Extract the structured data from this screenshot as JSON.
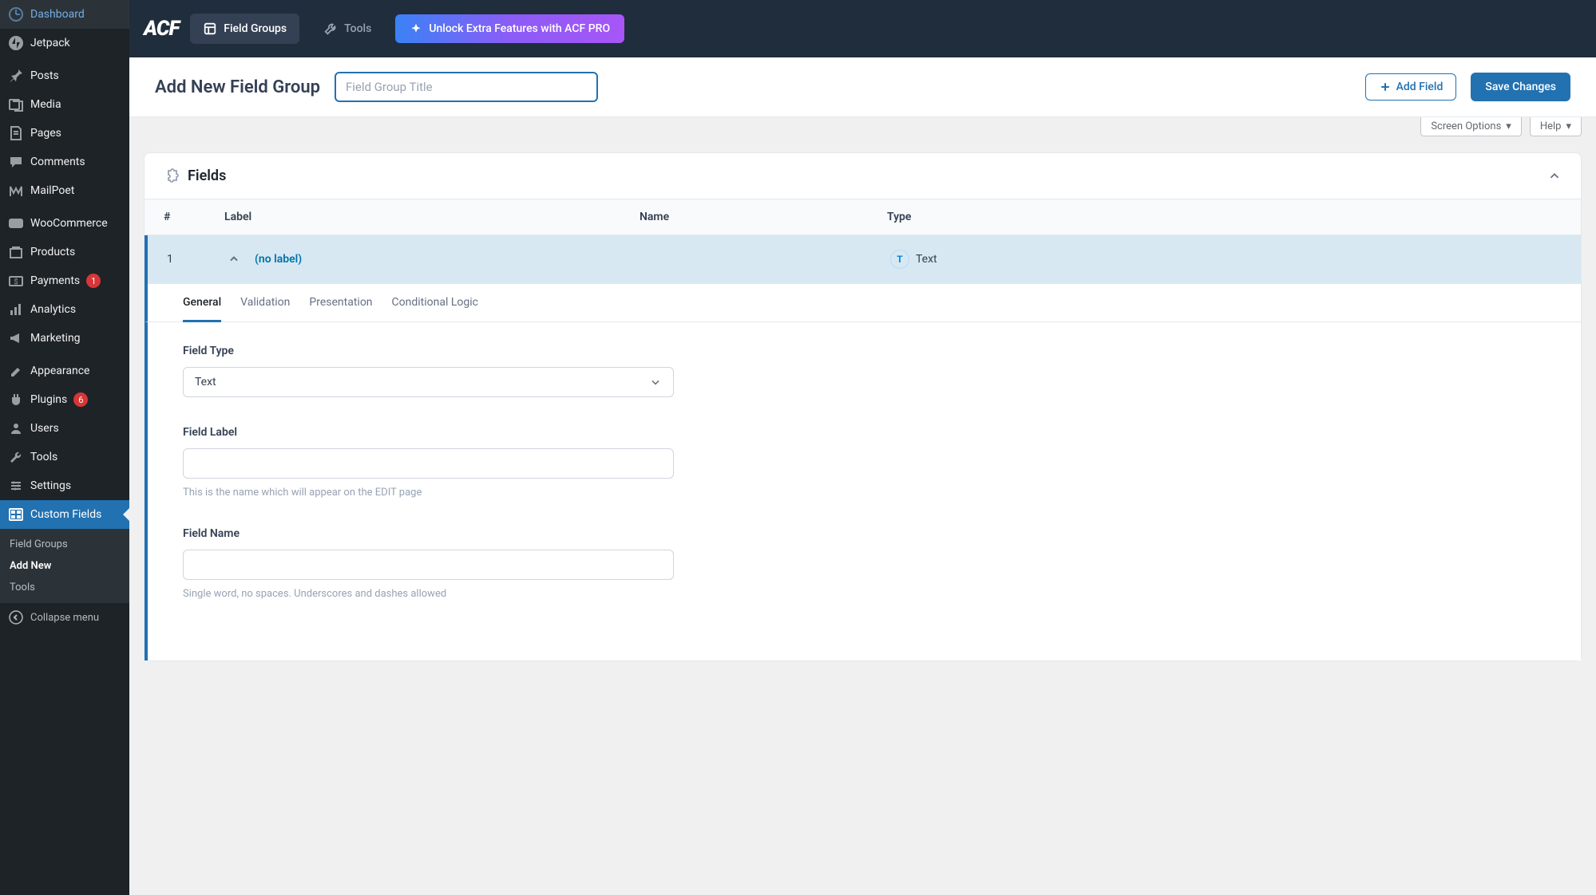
{
  "sidebar": {
    "items": [
      {
        "label": "Dashboard",
        "icon": "dashboard-icon"
      },
      {
        "label": "Jetpack",
        "icon": "jetpack-icon"
      },
      {
        "label": "Posts",
        "icon": "pin-icon"
      },
      {
        "label": "Media",
        "icon": "media-icon"
      },
      {
        "label": "Pages",
        "icon": "pages-icon"
      },
      {
        "label": "Comments",
        "icon": "comments-icon"
      },
      {
        "label": "MailPoet",
        "icon": "mailpoet-icon"
      },
      {
        "label": "WooCommerce",
        "icon": "woo-icon"
      },
      {
        "label": "Products",
        "icon": "products-icon"
      },
      {
        "label": "Payments",
        "icon": "payments-icon",
        "badge": "1"
      },
      {
        "label": "Analytics",
        "icon": "analytics-icon"
      },
      {
        "label": "Marketing",
        "icon": "marketing-icon"
      },
      {
        "label": "Appearance",
        "icon": "appearance-icon"
      },
      {
        "label": "Plugins",
        "icon": "plugins-icon",
        "badge": "6"
      },
      {
        "label": "Users",
        "icon": "users-icon"
      },
      {
        "label": "Tools",
        "icon": "tools-icon"
      },
      {
        "label": "Settings",
        "icon": "settings-icon"
      },
      {
        "label": "Custom Fields",
        "icon": "custom-fields-icon"
      }
    ],
    "sub": [
      "Field Groups",
      "Add New",
      "Tools"
    ],
    "collapse": "Collapse menu"
  },
  "topbar": {
    "logo": "ACF",
    "field_groups": "Field Groups",
    "tools": "Tools",
    "unlock": "Unlock Extra Features with ACF PRO"
  },
  "header": {
    "page_title": "Add New Field Group",
    "title_placeholder": "Field Group Title",
    "add_field": "Add Field",
    "save": "Save Changes"
  },
  "screenopts": {
    "screen_options": "Screen Options",
    "help": "Help"
  },
  "panel": {
    "title": "Fields"
  },
  "list": {
    "head": {
      "order": "#",
      "label": "Label",
      "name": "Name",
      "type": "Type"
    },
    "rows": [
      {
        "order": "1",
        "label": "(no label)",
        "name": "",
        "type": "Text"
      }
    ]
  },
  "tabs": [
    "General",
    "Validation",
    "Presentation",
    "Conditional Logic"
  ],
  "settings": {
    "field_type": {
      "label": "Field Type",
      "value": "Text"
    },
    "field_label": {
      "label": "Field Label",
      "value": "",
      "help": "This is the name which will appear on the EDIT page"
    },
    "field_name": {
      "label": "Field Name",
      "value": "",
      "help": "Single word, no spaces. Underscores and dashes allowed"
    }
  }
}
